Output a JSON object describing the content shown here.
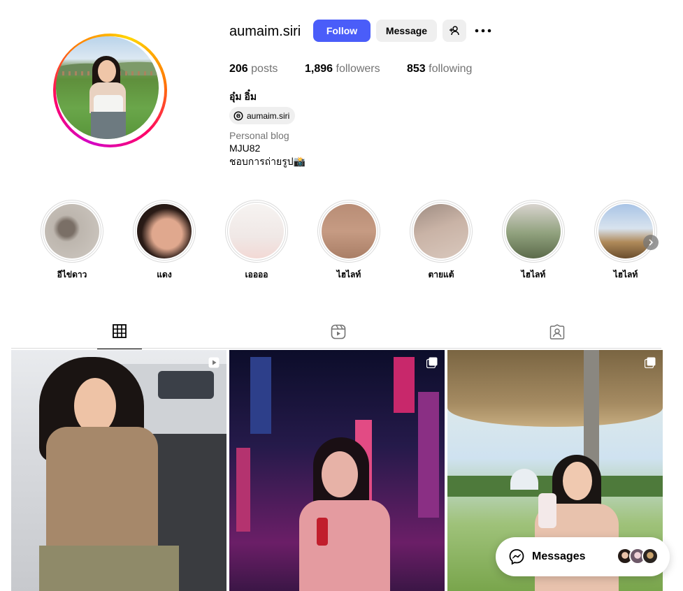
{
  "profile": {
    "username": "aumaim.siri",
    "follow_label": "Follow",
    "message_label": "Message",
    "stats": {
      "posts_count": "206",
      "posts_label": "posts",
      "followers_count": "1,896",
      "followers_label": "followers",
      "following_count": "853",
      "following_label": "following"
    },
    "full_name": "อุ๋ม อิ๋ม",
    "threads_handle": "aumaim.siri",
    "category": "Personal blog",
    "bio_lines": [
      "MJU82",
      "ชอบการถ่ายรูป📸"
    ]
  },
  "highlights": [
    {
      "label": "อีไข่ดาว"
    },
    {
      "label": "แดง"
    },
    {
      "label": "เออออ"
    },
    {
      "label": "ไฮไลท์"
    },
    {
      "label": "ตายแต้"
    },
    {
      "label": "ไฮไลท์"
    },
    {
      "label": "ไฮไลท์"
    }
  ],
  "tabs": [
    {
      "icon": "grid-icon",
      "active": true
    },
    {
      "icon": "reels-icon",
      "active": false
    },
    {
      "icon": "tagged-icon",
      "active": false
    }
  ],
  "posts": [
    {
      "badge": "video-icon"
    },
    {
      "badge": "carousel-icon"
    },
    {
      "badge": "carousel-icon"
    }
  ],
  "messages_widget": {
    "label": "Messages"
  },
  "colors": {
    "follow_button": "#4a5df9",
    "secondary_button": "#efefef",
    "muted_text": "#737373",
    "divider": "#dbdbdb"
  }
}
